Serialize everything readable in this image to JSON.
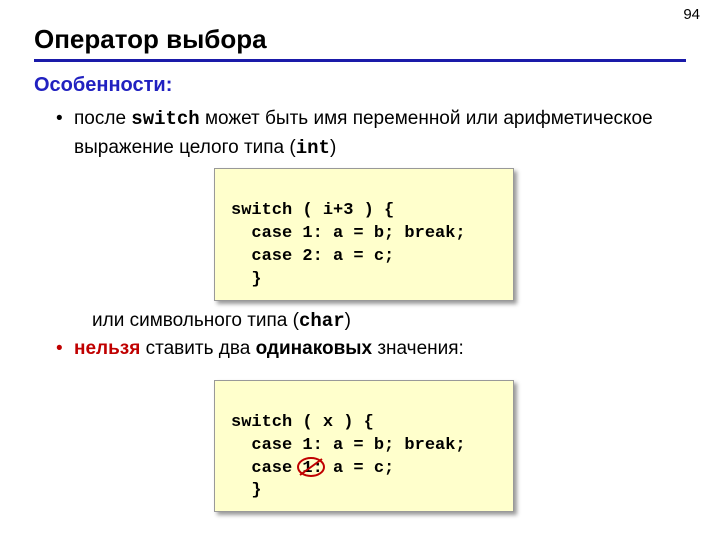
{
  "page_number": "94",
  "title": "Оператор выбора",
  "subhead": "Особенности:",
  "bullets": {
    "b1a": "после ",
    "b1_kw": "switch",
    "b1b": " может быть имя переменной или арифметическое выражение целого типа (",
    "b1_type": "int",
    "b1c": ")",
    "mid": "или символьного типа (",
    "mid_type": "char",
    "mid_c": ")",
    "b2_red": "нельзя",
    "b2a": " ставить два ",
    "b2_bold": "одинаковых",
    "b2b": " значения:"
  },
  "code1": {
    "l1": "switch ( i+3 ) {",
    "l2": "  case 1: a = b; break;",
    "l3": "  case 2: a = c;",
    "l4": "  }"
  },
  "code2": {
    "l1": "switch ( x ) {",
    "l2": "  case 1: a = b; break;",
    "l3_a": "  case ",
    "l3_b": "1:",
    "l3_c": " a = c;",
    "l4": "  }"
  }
}
